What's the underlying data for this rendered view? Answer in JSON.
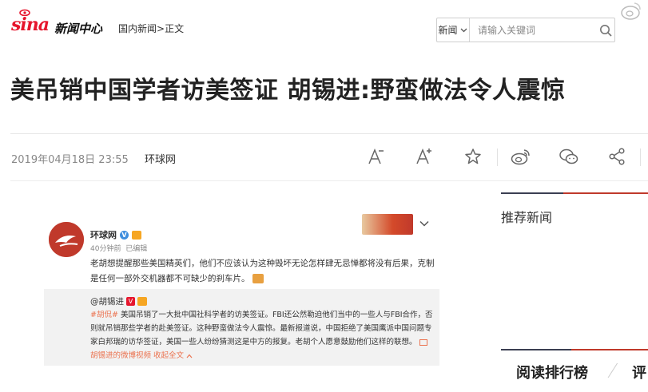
{
  "header": {
    "logo_text": "新闻中心",
    "breadcrumb": {
      "section": "国内新闻",
      "separator": ">",
      "current": "正文"
    },
    "search": {
      "category": "新闻",
      "placeholder": "请输入关键词"
    }
  },
  "article": {
    "title": "美吊销中国学者访美签证 胡锡进:野蛮做法令人震惊",
    "date": "2019年04月18日 23:55",
    "source": "环球网"
  },
  "toolbar": {
    "icons": [
      "font-smaller-icon",
      "font-larger-icon",
      "favorite-star-icon",
      "weibo-share-icon",
      "wechat-share-icon",
      "share-icon"
    ]
  },
  "embedded_post": {
    "author": "环球网",
    "time": "40分钟前",
    "edited": "已编辑",
    "text": "老胡想提醒那些美国精英们，他们不应该认为这种毁坏无论怎样肆无忌惮都将没有后果，克制是任何一部外交机器都不可缺少的刹车片。",
    "repost": {
      "author": "@胡锡进",
      "tag": "#胡侃#",
      "text": " 美国吊销了一大批中国社科学者的访美签证。FBI还公然勒迫他们当中的一些人与FBI合作，否则就吊销那些学者的赴美签证。这种野蛮做法令人震惊。最新报道说，中国拒绝了美国鹰派中国问题专家白邦瑞的访华签证，美国一些人纷纷猜测这是中方的报复。老胡个人愿意鼓励他们这样的联想。",
      "video_link": "胡锡进的微博视频",
      "collapse": "收起全文"
    }
  },
  "right_column": {
    "recommended_title": "推荐新闻",
    "rank_tab": "阅读排行榜",
    "rank_tab2": "评"
  },
  "colors": {
    "brand_red": "#e6162d",
    "accent_red": "#c0392b",
    "navy": "#3b3f52"
  }
}
